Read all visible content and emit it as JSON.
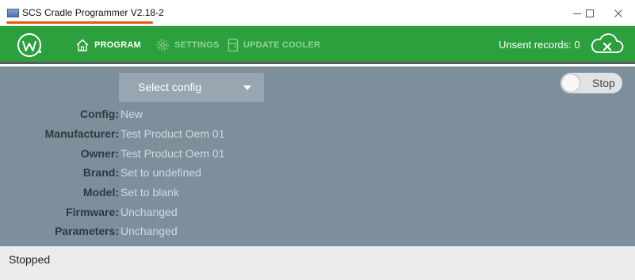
{
  "window": {
    "title": "SCS Cradle Programmer V2.18-2",
    "icon": "app-window-icon"
  },
  "nav": {
    "logo": "w-logo-icon",
    "items": [
      {
        "label": "PROGRAM",
        "icon": "home-icon",
        "active": true
      },
      {
        "label": "SETTINGS",
        "icon": "gear-icon",
        "active": false
      },
      {
        "label": "UPDATE COOLER",
        "icon": "cooler-icon",
        "active": false
      }
    ],
    "unsent_label": "Unsent records: 0",
    "cloud_icon": "cloud-x-icon"
  },
  "colors": {
    "nav_bg": "#2ca03c",
    "main_bg": "#7e8f9c",
    "title_accent": "#e35b12"
  },
  "config_select": {
    "selected": "Select config"
  },
  "toggle": {
    "label": "Stop",
    "on": false
  },
  "fields": [
    {
      "label": "Config:",
      "value": "New"
    },
    {
      "label": "Manufacturer:",
      "value": "Test Product Oem 01"
    },
    {
      "label": "Owner:",
      "value": "Test Product Oem 01"
    },
    {
      "label": "Brand:",
      "value": "Set to undefined"
    },
    {
      "label": "Model:",
      "value": "Set to blank"
    },
    {
      "label": "Firmware:",
      "value": "Unchanged"
    },
    {
      "label": "Parameters:",
      "value": "Unchanged"
    }
  ],
  "status": {
    "text": "Stopped"
  }
}
